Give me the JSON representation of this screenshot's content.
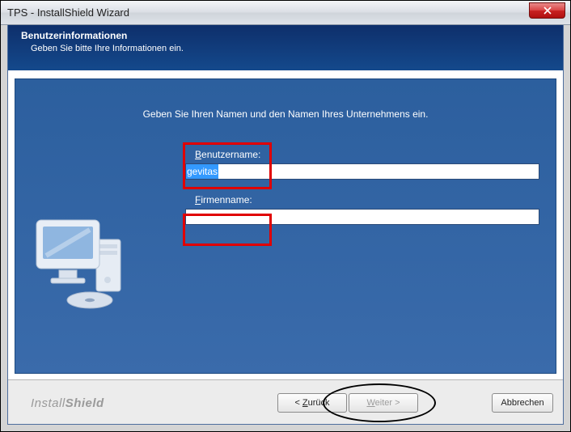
{
  "window": {
    "title": "TPS - InstallShield Wizard"
  },
  "header": {
    "title": "Benutzerinformationen",
    "subtitle": "Geben Sie bitte Ihre Informationen ein."
  },
  "main": {
    "prompt": "Geben Sie Ihren Namen und den Namen Ihres Unternehmens ein.",
    "username_label": "Benutzername:",
    "username_value": "gevitas",
    "company_label": "Firmenname:",
    "company_value": ""
  },
  "footer": {
    "brand_light": "Install",
    "brand_bold": "Shield",
    "back": "< Zurück",
    "next": "Weiter >",
    "cancel": "Abbrechen"
  }
}
